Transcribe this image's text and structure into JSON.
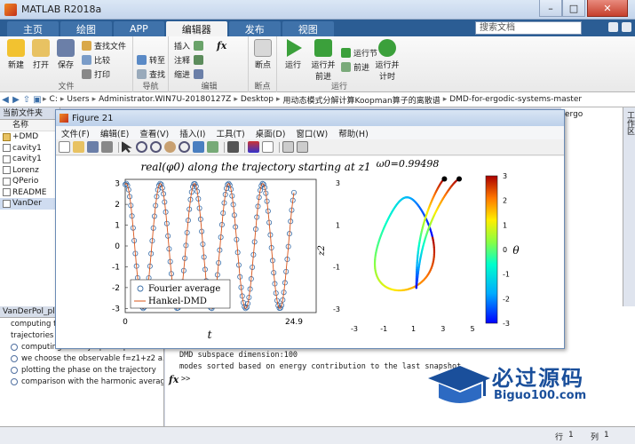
{
  "window": {
    "title": "MATLAB R2018a"
  },
  "tabs": [
    "主页",
    "绘图",
    "APP",
    "编辑器",
    "发布",
    "视图"
  ],
  "active_tab_index": 3,
  "search_placeholder": "搜索文档",
  "toolstrip": {
    "file": {
      "new": "新建",
      "open": "打开",
      "save": "保存",
      "find_files": "查找文件",
      "compare": "比较",
      "print": "打印",
      "group": "文件"
    },
    "nav": {
      "goto": "转至",
      "find": "查找",
      "group": "导航"
    },
    "edit": {
      "insert": "插入",
      "comment": "注释",
      "indent": "缩进",
      "group": "编辑"
    },
    "breakpoints": {
      "label": "断点",
      "group": "断点"
    },
    "run": {
      "run": "运行",
      "run_advance": "运行并\n前进",
      "run_section": "运行节",
      "advance": "前进",
      "run_time": "运行并\n计时",
      "group": "运行"
    }
  },
  "address": {
    "crumbs": [
      "C:",
      "Users",
      "Administrator.WIN7U-20180127Z",
      "Desktop",
      "用动态模式分解计算Koopman算子的离散谱",
      "DMD-for-ergodic-systems-master"
    ]
  },
  "left_panel": {
    "title": "当前文件夹",
    "column": "名称",
    "files": [
      "+DMD",
      "cavity1",
      "cavity1",
      "Lorenz",
      "QPerio",
      "README",
      "VanDer"
    ],
    "selected_index": 6
  },
  "details": {
    "title": "VanDerPol_pl",
    "items": [
      "computing th",
      "trajectories c",
      "computing the asymptotic phase for ...",
      "we choose the observable f=z1+z2 a...",
      "plotting the phase on the trajectory",
      "comparison with the harmonic average"
    ]
  },
  "command_window": {
    "lines": [
      "DMD subspace dimension:100",
      "modes sorted based on energy contribution to the last snapshot"
    ],
    "prompt": ">>"
  },
  "status": {
    "row_label": "行",
    "row": "1",
    "col_label": "列",
    "col": "1"
  },
  "right_vtab": "工作区",
  "right_label": "ergo",
  "watermark": {
    "title": "必过源码",
    "subtitle": "Biguo100.com"
  },
  "figure": {
    "title": "Figure 21",
    "menu": [
      "文件(F)",
      "编辑(E)",
      "查看(V)",
      "插入(I)",
      "工具(T)",
      "桌面(D)",
      "窗口(W)",
      "帮助(H)"
    ],
    "left_plot": {
      "title_text": "real(φ0) along the trajectory starting at z1",
      "xlabel": "t",
      "x_ticks": [
        "0",
        "24.9"
      ],
      "y_ticks": [
        "3",
        "2",
        "1",
        "0",
        "-1",
        "-2",
        "-3"
      ],
      "legend": [
        "Fourier average",
        "Hankel-DMD"
      ]
    },
    "right_plot": {
      "title_text": "ω0=0.99498",
      "ylabel": "z2",
      "x_ticks": [
        "-3",
        "-1",
        "1",
        "3",
        "5"
      ],
      "y_ticks": [
        "3",
        "1",
        "-1",
        "-3"
      ],
      "colorbar_ticks": [
        "3",
        "2",
        "1",
        "0",
        "-1",
        "-2",
        "-3"
      ],
      "colorbar_label": "θ"
    }
  },
  "chart_data": [
    {
      "type": "scatter",
      "title": "real(φ0) along the trajectory starting at z1",
      "xlabel": "t",
      "ylabel": "",
      "xlim": [
        0,
        24.9
      ],
      "ylim": [
        -3.2,
        3.2
      ],
      "series": [
        {
          "name": "Fourier average",
          "kind": "markers",
          "amplitude": 3,
          "period": 5.04,
          "phase": 1.4
        },
        {
          "name": "Hankel-DMD",
          "kind": "line",
          "amplitude": 3,
          "period": 5.04,
          "phase": 1.4
        }
      ],
      "legend": "bottom-left"
    },
    {
      "type": "line",
      "title": "ω0=0.99498",
      "xlabel": "",
      "ylabel": "z2",
      "xlim": [
        -3.6,
        5
      ],
      "ylim": [
        -3.6,
        3.6
      ],
      "colorbar": {
        "range": [
          -3,
          3
        ],
        "label": "θ"
      },
      "start_points": [
        [
          3.1,
          3.2
        ],
        [
          4.1,
          3.2
        ]
      ]
    }
  ]
}
